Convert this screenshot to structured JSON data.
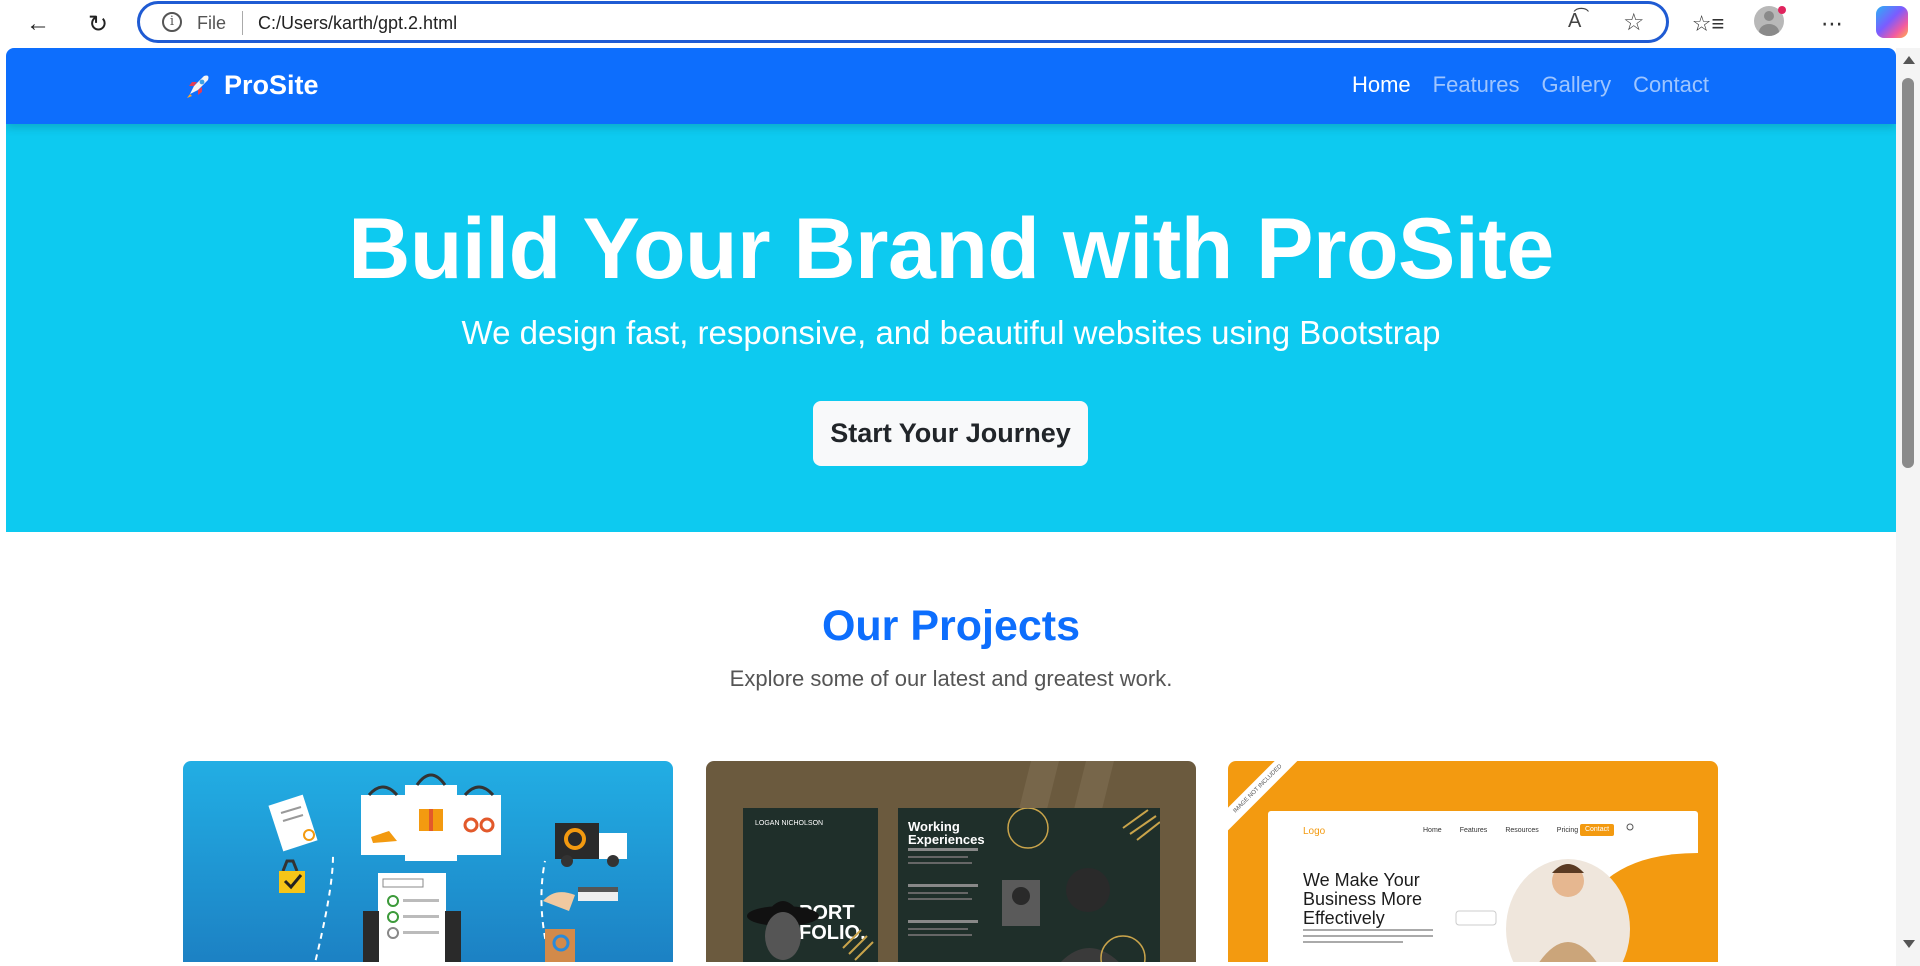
{
  "browser": {
    "file_label": "File",
    "url": "C:/Users/karth/gpt.2.html",
    "read_aloud_label": "Â"
  },
  "navbar": {
    "brand": "ProSite",
    "links": [
      {
        "label": "Home",
        "active": true
      },
      {
        "label": "Features",
        "active": false
      },
      {
        "label": "Gallery",
        "active": false
      },
      {
        "label": "Contact",
        "active": false
      }
    ]
  },
  "hero": {
    "title": "Build Your Brand with ProSite",
    "subtitle": "We design fast, responsive, and beautiful websites using Bootstrap",
    "cta": "Start Your Journey"
  },
  "projects": {
    "title": "Our Projects",
    "subtitle": "Explore some of our latest and greatest work.",
    "cards": [
      {
        "name": "ecommerce-illustration"
      },
      {
        "name": "portfolio-template",
        "left_title": "PORT FOLIO.",
        "left_header": "LOGAN NICHOLSON",
        "right_title": "Working Experiences"
      },
      {
        "name": "business-website-mockup",
        "ribbon": "IMAGE NOT INCLUDED",
        "logo": "Logo",
        "nav": [
          "Home",
          "Features",
          "Resources",
          "Pricing"
        ],
        "contact": "Contact",
        "headline": "We Make Your Business More Effectively"
      }
    ]
  },
  "colors": {
    "navbar": "#0d6efd",
    "hero": "#0dcaf0",
    "title_accent": "#0d6efd"
  }
}
